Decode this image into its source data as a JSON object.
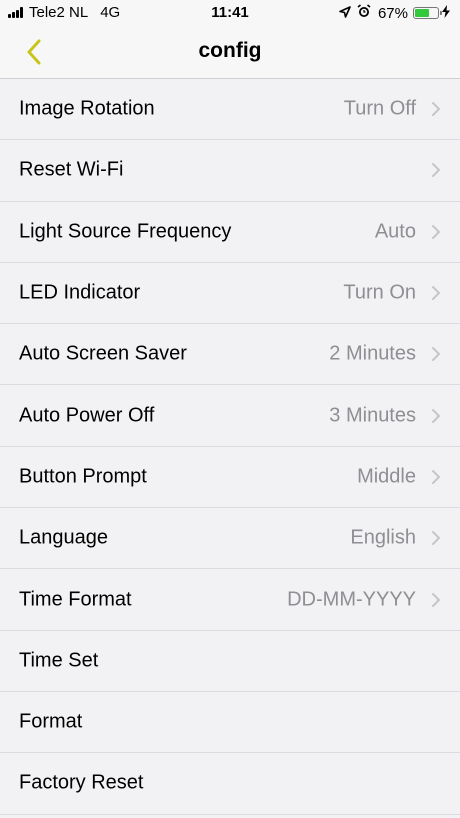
{
  "status_bar": {
    "carrier": "Tele2 NL",
    "network": "4G",
    "time": "11:41",
    "battery_percent": "67%",
    "battery_level": 0.67,
    "battery_color": "#33c93b",
    "icons": [
      "signal-icon",
      "location-icon",
      "alarm-icon",
      "battery-icon",
      "charging-icon"
    ]
  },
  "nav": {
    "title": "config",
    "back_icon": "chevron-left-icon",
    "accent_color": "#c8c41c"
  },
  "settings": [
    {
      "label": "Image Rotation",
      "value": "Turn Off",
      "chevron": true
    },
    {
      "label": "Reset Wi-Fi",
      "value": "",
      "chevron": true
    },
    {
      "label": "Light Source Frequency",
      "value": "Auto",
      "chevron": true
    },
    {
      "label": "LED Indicator",
      "value": "Turn On",
      "chevron": true
    },
    {
      "label": "Auto Screen Saver",
      "value": "2 Minutes",
      "chevron": true
    },
    {
      "label": "Auto Power Off",
      "value": "3 Minutes",
      "chevron": true
    },
    {
      "label": "Button Prompt",
      "value": "Middle",
      "chevron": true
    },
    {
      "label": "Language",
      "value": "English",
      "chevron": true
    },
    {
      "label": "Time Format",
      "value": "DD-MM-YYYY",
      "chevron": true
    },
    {
      "label": "Time Set",
      "value": "",
      "chevron": false
    },
    {
      "label": "Format",
      "value": "",
      "chevron": false
    },
    {
      "label": "Factory Reset",
      "value": "",
      "chevron": false
    }
  ]
}
